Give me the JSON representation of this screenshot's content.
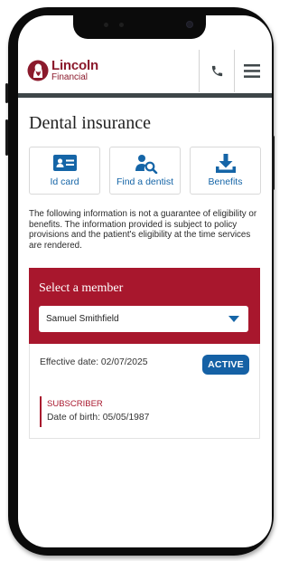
{
  "brand": {
    "name": "Lincoln",
    "sub": "Financial",
    "color": "#8b1a2c"
  },
  "header": {
    "actions": [
      {
        "icon": "phone-icon"
      },
      {
        "icon": "menu-icon"
      }
    ]
  },
  "page": {
    "title": "Dental insurance"
  },
  "quick_links": [
    {
      "label": "Id card",
      "icon": "id-card-icon"
    },
    {
      "label": "Find a dentist",
      "icon": "find-dentist-icon"
    },
    {
      "label": "Benefits",
      "icon": "benefits-download-icon"
    }
  ],
  "disclaimer": "The following information is not a guarantee of eligibility or benefits. The information provided is subject to policy provisions and the patient's eligibility at the time services are rendered.",
  "member_select": {
    "label": "Select a member",
    "value": "Samuel Smithfield",
    "panel_color": "#a8172d"
  },
  "member": {
    "effective_date": "Effective date: 02/07/2025",
    "status": "ACTIVE",
    "status_color": "#1561a5",
    "role": "SUBSCRIBER",
    "dob": "Date of birth: 05/05/1987"
  }
}
